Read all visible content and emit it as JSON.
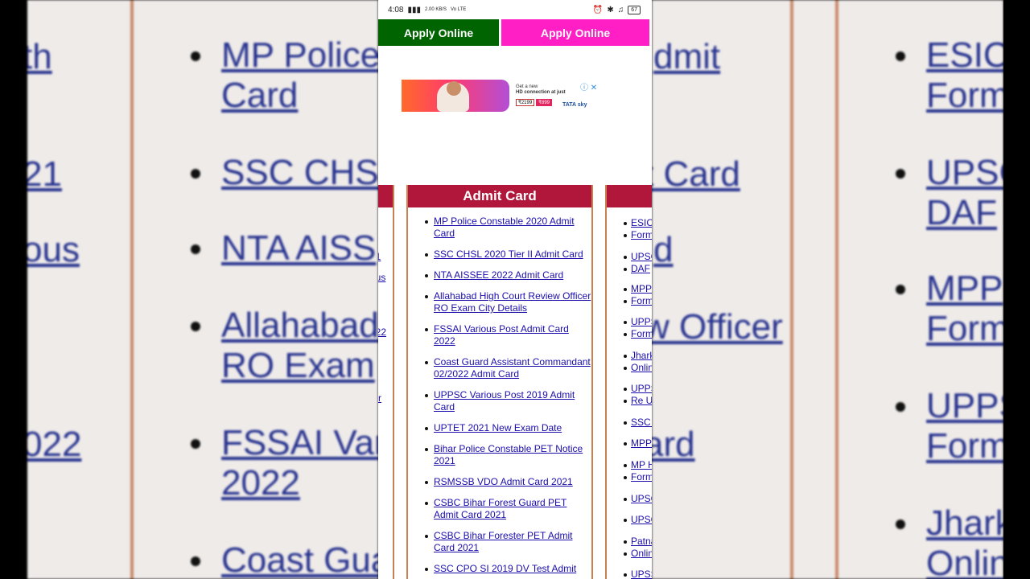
{
  "status_bar": {
    "time": "4:08",
    "network": "2.00 KB/S",
    "carrier": "Vo LTE",
    "battery": "67"
  },
  "buttons": {
    "apply_left": "Apply Online",
    "apply_right": "Apply Online"
  },
  "ad": {
    "line1": "Get a new",
    "line2": "HD connection at just",
    "price_old": "₹2199",
    "price_new": "₹899",
    "brand": "TATA sky",
    "close": "ⓘ ✕"
  },
  "admit_card": {
    "title": "Admit Card",
    "items": [
      "MP Police Constable 2020 Admit Card",
      "SSC CHSL 2020 Tier II Admit Card",
      "NTA AISSEE 2022 Admit Card",
      "Allahabad High Court Review Officer RO Exam City Details",
      "FSSAI Various Post Admit Card 2022",
      "Coast Guard Assistant Commandant 02/2022 Admit Card",
      "UPPSC Various Post 2019 Admit Card",
      "UPTET 2021 New Exam Date",
      "Bihar Police Constable PET Notice 2021",
      "RSMSSB VDO Admit Card 2021",
      "CSBC Bihar Forest Guard PET Admit Card 2021",
      "CSBC Bihar Forester PET Admit Card 2021",
      "SSC CPO SI 2019 DV Test Admit"
    ]
  },
  "left_fragments": [
    "th",
    "21",
    "ous",
    "022",
    "t",
    "ter"
  ],
  "right_fragments": [
    "ESIC",
    "Form",
    "UPSC",
    "DAF",
    "MPP",
    "Form",
    "UPPS",
    "Form",
    "Jhark",
    "Onlin",
    "UPPS",
    "Re Up",
    "SSC C",
    "MPP",
    "MP H",
    "Form",
    "UPSC",
    "UPSC",
    "Patna",
    "Onlin",
    "UPSS"
  ],
  "background_left": {
    "items": [
      "MP Police",
      "Card",
      "SSC CHSL",
      "NTA AISS",
      "Allahabad",
      "RO Exam",
      "FSSAI Var",
      "2022",
      "Coast Gua"
    ],
    "edge": [
      "th",
      "21",
      "ous",
      "022"
    ]
  },
  "background_right": {
    "items": [
      "ESIC",
      "Form",
      "UPSC",
      "DAF",
      "MPP",
      "Form",
      "UPPS",
      "Form",
      "Jhark",
      "Onlin"
    ],
    "edge": [
      "dmit",
      "t Card",
      "d",
      "w Officer",
      "ard"
    ]
  }
}
